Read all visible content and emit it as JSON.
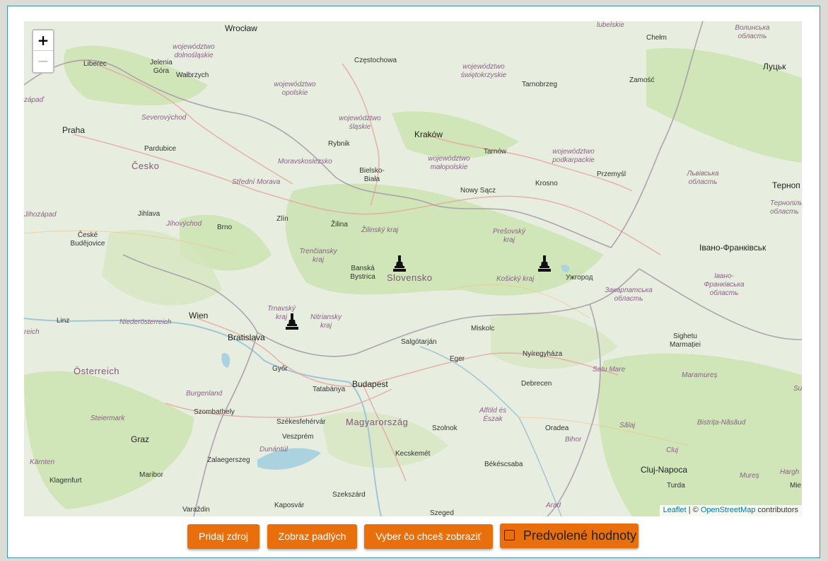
{
  "map": {
    "zoom_in": "+",
    "zoom_out": "−",
    "attribution": {
      "leaflet": "Leaflet",
      "sep": " | © ",
      "osm": "OpenStreetMap",
      "tail": " contributors"
    },
    "countries": {
      "cz": "Česko",
      "sk": "Slovensko",
      "hu": "Magyarország",
      "at": "Österreich"
    },
    "cities": {
      "wroclaw": "Wrocław",
      "czestochowa": "Częstochowa",
      "liberec": "Liberec",
      "jelenia": "Jelenia Góra",
      "walbrzych": "Wałbrzych",
      "praha": "Praha",
      "pardubice": "Pardubice",
      "rybnik": "Rybnik",
      "krakow": "Kraków",
      "tarnow": "Tarnów",
      "tarnobrzeg": "Tarnobrzeg",
      "zamosc": "Zamość",
      "chelm": "Chełm",
      "lutsk": "Луцьк",
      "bielsko": "Bielsko-Biała",
      "nowy_sacz": "Nowy Sącz",
      "krosno": "Krosno",
      "przemysl": "Przemyśl",
      "ternopil": "Терноп",
      "jihlava": "Jihlava",
      "brno": "Brno",
      "zlin": "Zlín",
      "zilina": "Žilina",
      "ceske_budejovice": "České Budějovice",
      "banska": "Banská Bystrica",
      "frankivsk": "Івано-Франківськ",
      "uzhhorod": "Ужгород",
      "wien": "Wien",
      "linz": "Linz",
      "bratislava": "Bratislava",
      "miskolc": "Miskolc",
      "salgotarjan": "Salgótarján",
      "sighetu": "Sighetu Marmației",
      "gyor": "Győr",
      "eger": "Eger",
      "nyiregyhaza": "Nyíregyháza",
      "tatabanya": "Tatabánya",
      "budapest": "Budapest",
      "debrecen": "Debrecen",
      "szombathely": "Szombathely",
      "szekesfehervar": "Székesfehérvár",
      "szolnok": "Szolnok",
      "oradea": "Oradea",
      "veszprem": "Veszprém",
      "graz": "Graz",
      "zalaegerszeg": "Zalaegerszeg",
      "kecskemet": "Kecskemét",
      "bekescsaba": "Békéscsaba",
      "cluj": "Cluj-Napoca",
      "klagenfurt": "Klagenfurt",
      "maribor": "Maribor",
      "turda": "Turda",
      "varazdin": "Varaždin",
      "kaposvar": "Kaposvár",
      "szekszard": "Szekszárd",
      "szeged": "Szeged",
      "mie": "Mie"
    },
    "regions": {
      "lubelskie": "lubelskie",
      "volyn": "Волинська область",
      "dolnoslaskie": "województwo dolnośląskie",
      "opolskie": "województwo opolskie",
      "swietokrzyskie": "województwo świętokrzyskie",
      "zapad": "zápaď",
      "severovychod": "Severovýchod",
      "slaskie": "województwo śląskie",
      "moravskoslezsko": "Moravskoslezsko",
      "malopolskie": "województwo małopolskie",
      "podkarpackie": "województwo podkarpackie",
      "lviv": "Львівська область",
      "stredni_morava": "Střední Morava",
      "jihozapad": "Jihozápad",
      "jihovychod": "Jihovýchod",
      "ternopil_obl": "Тернопіль область",
      "zilinsky": "Žilinský kraj",
      "presovsky": "Prešovský kraj",
      "trenciansky": "Trenčiansky kraj",
      "kosicky": "Košický kraj",
      "zakarpattia": "Закарпатська область",
      "frankivsk_obl": "Івано-Франківська область",
      "trnavsky": "Trnavský kraj",
      "nitriansky": "Nitriansky kraj",
      "niederosterreich": "Niederösterreich",
      "oberosterreich": "reich",
      "satu_mare": "Satu Mare",
      "maramures": "Maramureș",
      "burgenland": "Burgenland",
      "alfold": "Alföld és Észak",
      "steiermark": "Steiermark",
      "salaj": "Sălaj",
      "bistrita": "Bistrița-Năsăud",
      "dunantul": "Dunántúl",
      "bihor": "Bihor",
      "cluj_reg": "Cluj",
      "karnten": "Kärnten",
      "mures": "Mureș",
      "harghita": "Hargh",
      "arad": "Arad",
      "su": "Su"
    },
    "markers": [
      {
        "name": "marker-slovensko-center"
      },
      {
        "name": "marker-kosice"
      },
      {
        "name": "marker-trnava"
      }
    ]
  },
  "toolbar": {
    "add_source": "Pridaj zdroj",
    "show_fallen": "Zobraz padlých",
    "choose_view": "Vyber čo chceš zobraziť",
    "defaults": "Predvolené hodnoty",
    "defaults_checked": false
  },
  "colors": {
    "button": "#e96f0c",
    "frame": "#3a96a8",
    "link": "#0078a8"
  }
}
